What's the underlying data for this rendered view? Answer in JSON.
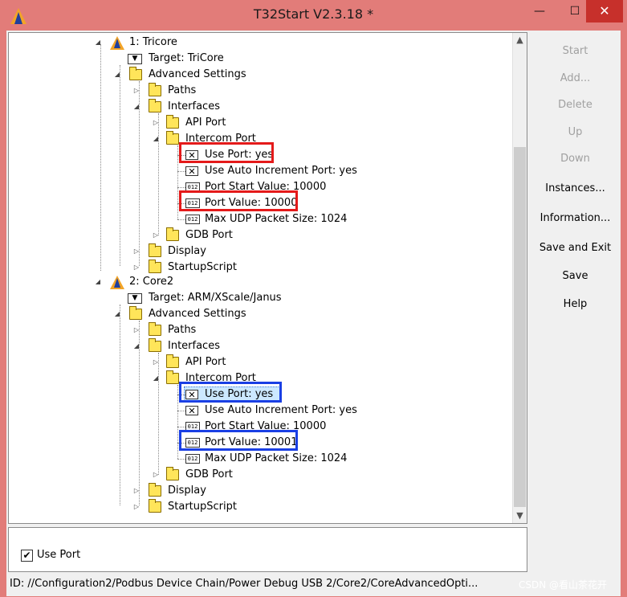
{
  "window": {
    "title": "T32Start V2.3.18 *",
    "minimize_glyph": "—",
    "maximize_glyph": "☐",
    "close_glyph": "✕"
  },
  "tree": {
    "core1": {
      "label": "1: Tricore",
      "target": "Target: TriCore",
      "advanced": "Advanced Settings",
      "paths": "Paths",
      "interfaces": "Interfaces",
      "api_port": "API Port",
      "intercom_port": "Intercom Port",
      "use_port": "Use Port: yes",
      "use_auto_increment": "Use Auto Increment Port: yes",
      "port_start_value": "Port Start Value: 10000",
      "port_value": "Port Value: 10000",
      "max_udp": "Max UDP Packet Size: 1024",
      "gdb_port": "GDB Port",
      "display": "Display",
      "startup_script": "StartupScript"
    },
    "core2": {
      "label": "2: Core2",
      "target": "Target: ARM/XScale/Janus",
      "advanced": "Advanced Settings",
      "paths": "Paths",
      "interfaces": "Interfaces",
      "api_port": "API Port",
      "intercom_port": "Intercom Port",
      "use_port": "Use Port: yes",
      "use_auto_increment": "Use Auto Increment Port: yes",
      "port_start_value": "Port Start Value: 10000",
      "port_value": "Port Value: 10001",
      "max_udp": "Max UDP Packet Size: 1024",
      "gdb_port": "GDB Port",
      "display": "Display",
      "startup_script": "StartupScript"
    },
    "icons": {
      "expanded": "◢",
      "collapsed": "▷",
      "checkbox_glyph": "✕",
      "num_glyph": "012",
      "target_glyph": "▼"
    }
  },
  "side_buttons": {
    "start": "Start",
    "add": "Add...",
    "delete": "Delete",
    "up": "Up",
    "down": "Down",
    "instances": "Instances...",
    "information": "Information...",
    "save_and_exit": "Save and Exit",
    "save": "Save",
    "help": "Help"
  },
  "bottom": {
    "use_port_label": "Use Port",
    "use_port_checked": true,
    "check_glyph": "✔"
  },
  "status": {
    "text": "ID: //Configuration2/Podbus Device Chain/Power Debug USB 2/Core2/CoreAdvancedOpti...",
    "watermark": "CSDN @看山茶花开"
  },
  "colors": {
    "frame": "#e27c79",
    "close_button": "#c7302b",
    "highlight_red": "#e41a1a",
    "highlight_blue": "#1a3fe4",
    "folder": "#ffe55a",
    "selection": "#cce8ff"
  }
}
